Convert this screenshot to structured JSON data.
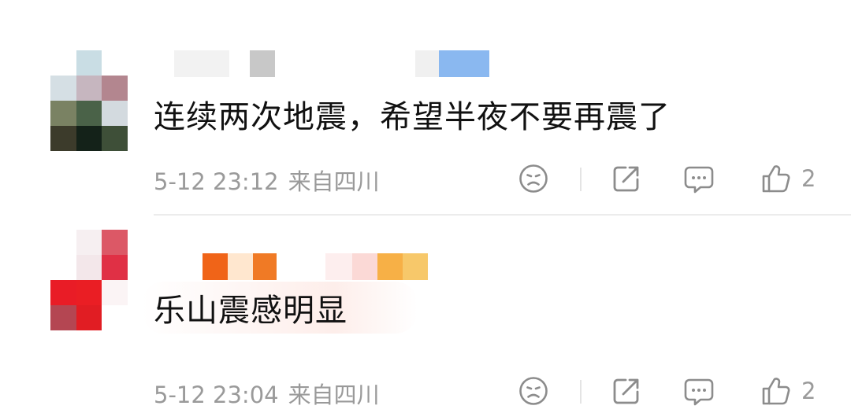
{
  "comments": [
    {
      "text": "连续两次地震，希望半夜不要再震了",
      "date": "5-12 23:12",
      "location": "来自四川",
      "likes": "2",
      "avatar_pixels": [
        "#ffffff",
        "#c9dde4",
        "#ffffff",
        "#d5dfe4",
        "#c6b6bf",
        "#b3868f",
        "#7a8263",
        "#4a6248",
        "#d3dadf",
        "#3c3b2b",
        "#142219",
        "#3e4f38"
      ],
      "username_pixels": [
        "#ffffff",
        "#f2f2f2",
        "#ffffff",
        "#c8c8c8",
        "#ffffff",
        "#ffffff",
        "#ffffff",
        "#ffffff",
        "#f0f0f0",
        "#8ab8f0"
      ]
    },
    {
      "text": "乐山震感明显",
      "date": "5-12 23:04",
      "location": "来自四川",
      "likes": "2",
      "avatar_pixels": [
        "#ffffff",
        "#f6eff1",
        "#dc5866",
        "#ffffff",
        "#f3e7ea",
        "#e03045",
        "#e91c26",
        "#ea1e24",
        "#fbf4f5",
        "#b44652",
        "#e11d23",
        "#ffffff"
      ],
      "username_pixels": [
        "#ffffff",
        "#f06418",
        "#ffe7cf",
        "#f07a25",
        "#ffffff",
        "#fdeeee",
        "#fbd9d6",
        "#f7b046",
        "#f7c86a"
      ]
    }
  ],
  "colors": {
    "text": "#111111",
    "meta": "#9a9a9a",
    "icon": "#8c8c8c",
    "divider": "#ececec"
  },
  "icons": [
    "dislike-face-icon",
    "share-icon",
    "comment-icon",
    "thumbs-up-icon"
  ]
}
